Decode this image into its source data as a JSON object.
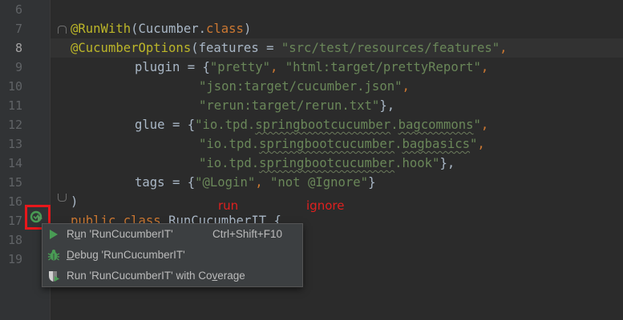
{
  "editor": {
    "line_numbers": [
      "6",
      "7",
      "8",
      "9",
      "10",
      "11",
      "12",
      "13",
      "14",
      "15",
      "16",
      "17",
      "18",
      "19"
    ],
    "active_line": "8",
    "lines": {
      "l7": {
        "ann": "@RunWith",
        "p1": "(Cucumber.",
        "kw": "class",
        "p2": ")"
      },
      "l8": {
        "ann": "@CucumberOptions",
        "p1": "(features = ",
        "str": "\"src/test/resources/features\"",
        "p2": ","
      },
      "l9": {
        "p1": "plugin = {",
        "s1": "\"pretty\"",
        "p2": ", ",
        "s2": "\"html:target/prettyReport\"",
        "p3": ","
      },
      "l10": {
        "s1": "\"json:target/cucumber.json\"",
        "p1": ","
      },
      "l11": {
        "s1": "\"rerun:target/rerun.txt\"",
        "p1": "},"
      },
      "l12": {
        "p1": "glue = {",
        "s_a": "\"io.tpd.",
        "s_b": "springbootcucumber",
        "s_c": ".",
        "s_d": "bagcommons",
        "s_e": "\"",
        "p2": ","
      },
      "l13": {
        "s_a": "\"io.tpd.",
        "s_b": "springbootcucumber",
        "s_c": ".",
        "s_d": "bagbasics",
        "s_e": "\"",
        "p2": ","
      },
      "l14": {
        "s_a": "\"io.tpd.",
        "s_b": "springbootcucumber",
        "s_c": ".hook\"",
        "p2": "},"
      },
      "l15": {
        "p1": "tags = {",
        "s1": "\"@Login\"",
        "p2": ", ",
        "s2": "\"not @Ignore\"",
        "p3": "}"
      },
      "l16": {
        "p1": ")"
      },
      "l17": {
        "kw": "public class ",
        "p1": "RunCucumberIT {"
      }
    }
  },
  "annotations": {
    "run": "run",
    "ignore": "ignore"
  },
  "context_menu": {
    "items": [
      {
        "label_pre": "R",
        "label_ul": "u",
        "label_post": "n 'RunCucumberIT'",
        "shortcut": "Ctrl+Shift+F10",
        "icon": "run-icon"
      },
      {
        "label_pre": "",
        "label_ul": "D",
        "label_post": "ebug 'RunCucumberIT'",
        "shortcut": "",
        "icon": "debug-icon"
      },
      {
        "label_pre": "Run 'RunCucumberIT' with Co",
        "label_ul": "v",
        "label_post": "erage",
        "shortcut": "",
        "icon": "coverage-icon"
      }
    ]
  },
  "colors": {
    "background": "#2b2b2b",
    "annotation": "#bbb529",
    "keyword": "#cc7832",
    "string": "#6a8759",
    "highlight_box": "#e8171b",
    "run_green": "#499c54"
  }
}
